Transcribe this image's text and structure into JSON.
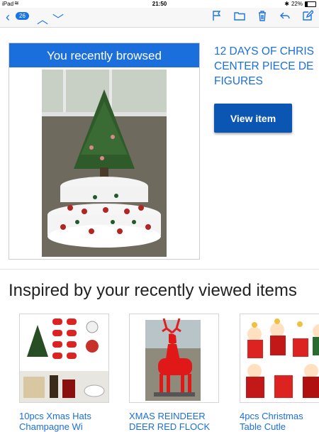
{
  "status_bar": {
    "device": "iPad",
    "time": "21:50",
    "battery": "22%"
  },
  "toolbar": {
    "unread_count": "26",
    "icons": [
      "flag-icon",
      "folder-icon",
      "trash-icon",
      "reply-icon",
      "compose-icon"
    ]
  },
  "recently_browsed": {
    "header": "You recently browsed",
    "title_line1": "12 DAYS OF CHRIS",
    "title_line2": "CENTER PIECE DE",
    "title_line3": "FIGURES",
    "button_label": "View item"
  },
  "inspired": {
    "heading": "Inspired by your recently viewed items",
    "items": [
      {
        "label_line1": "10pcs Xmas Hats",
        "label_line2": "Champagne Wi"
      },
      {
        "label_line1": "XMAS REINDEER",
        "label_line2": "DEER RED FLOCK"
      },
      {
        "label_line1": "4pcs Christmas",
        "label_line2": "Table Cutle"
      }
    ]
  },
  "colors": {
    "link_blue": "#1a6fdc",
    "button_blue": "#0c56b3",
    "ios_blue": "#1a73e8"
  }
}
